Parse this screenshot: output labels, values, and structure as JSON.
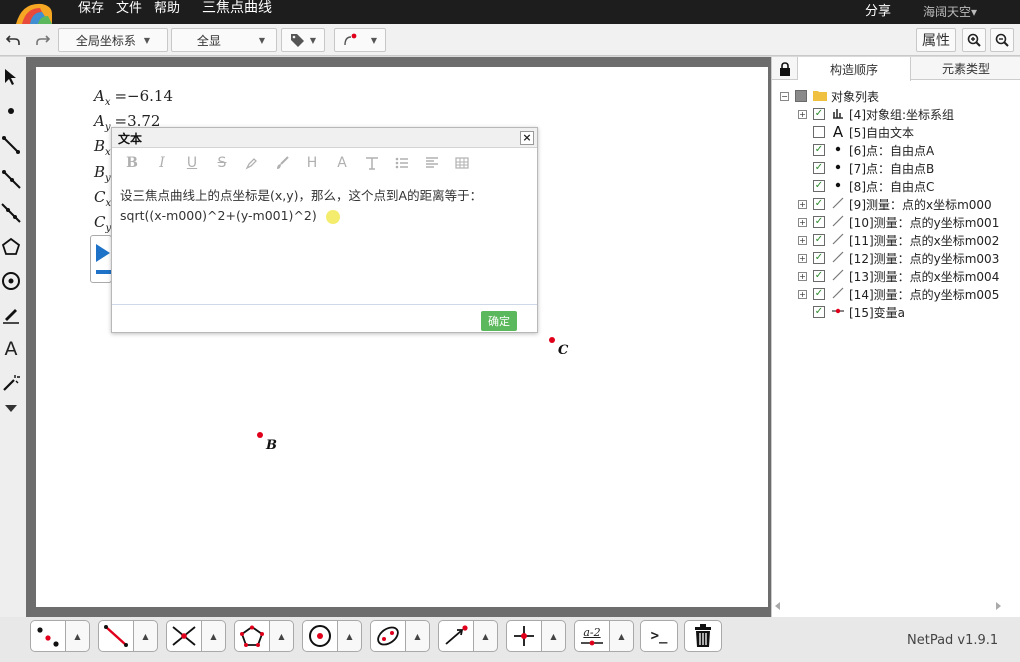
{
  "topbar": {
    "menu_save": "保存",
    "menu_file": "文件",
    "menu_help": "帮助",
    "doc_title": "三焦点曲线",
    "share": "分享",
    "user": "海阔天空",
    "user_caret": "▾"
  },
  "toolbar": {
    "coord_system": "全局坐标系",
    "view_all": "全显",
    "properties": "属性"
  },
  "canvas": {
    "measures": [
      {
        "name": "A",
        "sub": "x",
        "value": "=−6.14"
      },
      {
        "name": "A",
        "sub": "y",
        "value": "=3.72"
      },
      {
        "name": "B",
        "sub": "x",
        "value": ""
      },
      {
        "name": "B",
        "sub": "y",
        "value": ""
      },
      {
        "name": "C",
        "sub": "x",
        "value": ""
      },
      {
        "name": "C",
        "sub": "y",
        "value": ""
      }
    ],
    "points": [
      {
        "label": "C",
        "color": "#e0001b"
      },
      {
        "label": "B",
        "color": "#e0001b"
      }
    ]
  },
  "dialog": {
    "title": "文本",
    "close": "×",
    "tools": [
      "bold-icon",
      "italic-icon",
      "underline-icon",
      "strikethrough-icon",
      "highlight-icon",
      "brush-icon",
      "heading-icon",
      "font-color-icon",
      "clear-format-icon",
      "list-icon",
      "align-icon",
      "table-icon"
    ],
    "text_line1": "设三焦点曲线上的点坐标是(x,y)，那么，这个点到A的距离等于：",
    "text_line2": "sqrt((x-m000)^2+(y-m001)^2)",
    "ok": "确定",
    "ok_color": "#5cb85c"
  },
  "panel": {
    "tab_order": "构造顺序",
    "tab_type": "元素类型",
    "tree": [
      {
        "text": "对象列表",
        "level": 0,
        "expander": "⊟",
        "checked": null,
        "icon": "folder-icon"
      },
      {
        "text": "[4]对象组:坐标系组",
        "level": 1,
        "expander": "⊞",
        "checked": true,
        "icon": "chart-icon"
      },
      {
        "text": "[5]自由文本",
        "level": 1,
        "expander": "",
        "checked": false,
        "icon": "text-icon"
      },
      {
        "text": "[6]点：自由点A",
        "level": 1,
        "expander": "",
        "checked": true,
        "icon": "point-icon"
      },
      {
        "text": "[7]点：自由点B",
        "level": 1,
        "expander": "",
        "checked": true,
        "icon": "point-icon"
      },
      {
        "text": "[8]点：自由点C",
        "level": 1,
        "expander": "",
        "checked": true,
        "icon": "point-icon"
      },
      {
        "text": "[9]测量：点的x坐标m000",
        "level": 1,
        "expander": "⊞",
        "checked": true,
        "icon": "measure-icon"
      },
      {
        "text": "[10]测量：点的y坐标m001",
        "level": 1,
        "expander": "⊞",
        "checked": true,
        "icon": "measure-icon"
      },
      {
        "text": "[11]测量：点的x坐标m002",
        "level": 1,
        "expander": "⊞",
        "checked": true,
        "icon": "measure-icon"
      },
      {
        "text": "[12]测量：点的y坐标m003",
        "level": 1,
        "expander": "⊞",
        "checked": true,
        "icon": "measure-icon"
      },
      {
        "text": "[13]测量：点的x坐标m004",
        "level": 1,
        "expander": "⊞",
        "checked": true,
        "icon": "measure-icon"
      },
      {
        "text": "[14]测量：点的y坐标m005",
        "level": 1,
        "expander": "⊞",
        "checked": true,
        "icon": "measure-icon"
      },
      {
        "text": "[15]变量a",
        "level": 1,
        "expander": "",
        "checked": true,
        "icon": "variable-icon"
      }
    ]
  },
  "bottom": {
    "tools": [
      "point-tool",
      "segment-tool",
      "intersection-tool",
      "polygon-tool",
      "circle-tool",
      "conic-tool",
      "vector-tool",
      "transform-tool",
      "measure-tool"
    ],
    "measure_label": "a-2",
    "console": ">_",
    "version": "NetPad v1.9.1"
  }
}
